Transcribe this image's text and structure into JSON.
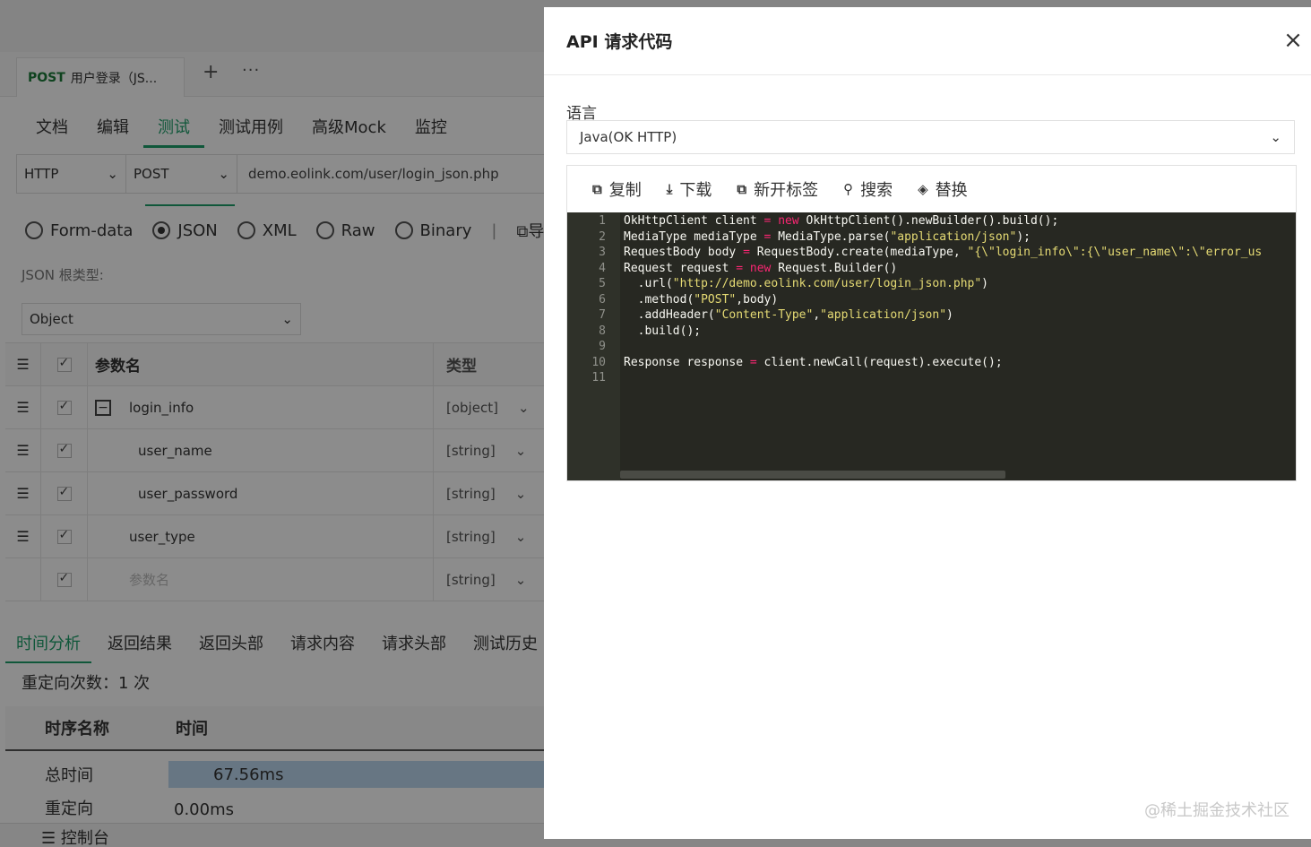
{
  "background": {
    "request_tab": {
      "method": "POST",
      "title": "用户登录（JS..."
    },
    "tab_plus": "+",
    "tab_more": "···",
    "subnav": [
      "文档",
      "编辑",
      "测试",
      "测试用例",
      "高级Mock",
      "监控"
    ],
    "subnav_active_index": 2,
    "protocol": "HTTP",
    "method": "POST",
    "url": "demo.eolink.com/user/login_json.php",
    "body_types": [
      "Form-data",
      "JSON",
      "XML",
      "Raw",
      "Binary"
    ],
    "body_type_selected": "JSON",
    "import_label": "导",
    "json_root_label": "JSON 根类型:",
    "json_root_value": "Object",
    "param_table": {
      "headers": {
        "name": "参数名",
        "type": "类型"
      },
      "rows": [
        {
          "name": "login_info",
          "type": "[object]",
          "level": 0,
          "collapsible": true
        },
        {
          "name": "user_name",
          "type": "[string]",
          "level": 1
        },
        {
          "name": "user_password",
          "type": "[string]",
          "level": 1
        },
        {
          "name": "user_type",
          "type": "[string]",
          "level": 0
        },
        {
          "name": "参数名",
          "type": "[string]",
          "level": 0,
          "placeholder": true
        }
      ]
    },
    "result_tabs": [
      "时间分析",
      "返回结果",
      "返回头部",
      "请求内容",
      "请求头部",
      "测试历史"
    ],
    "result_tab_active": "时间分析",
    "redirect_text": "重定向次数：1 次",
    "timing": {
      "headers": [
        "时序名称",
        "时间"
      ],
      "rows": [
        {
          "name": "总时间",
          "value": "67.56ms"
        },
        {
          "name": "重定向",
          "value": "0.00ms"
        }
      ]
    },
    "console_label": "控制台"
  },
  "modal": {
    "title": "API 请求代码",
    "close_icon": "×",
    "language_label": "语言",
    "language_value": "Java(OK HTTP)",
    "toolbar": {
      "copy": "复制",
      "download": "下载",
      "new_tab": "新开标签",
      "search": "搜索",
      "replace": "替换"
    },
    "code_lines": [
      "OkHttpClient client = new OkHttpClient().newBuilder().build();",
      "MediaType mediaType = MediaType.parse(\"application/json\");",
      "RequestBody body = RequestBody.create(mediaType, \"{\\\"login_info\\\":{\\\"user_name\\\":\\\"error_us",
      "Request request = new Request.Builder()",
      "  .url(\"http://demo.eolink.com/user/login_json.php\")",
      "  .method(\"POST\",body)",
      "  .addHeader(\"Content-Type\",\"application/json\")",
      "  .build();",
      "",
      "Response response = client.newCall(request).execute();",
      ""
    ]
  },
  "watermark": "@稀土掘金技术社区"
}
